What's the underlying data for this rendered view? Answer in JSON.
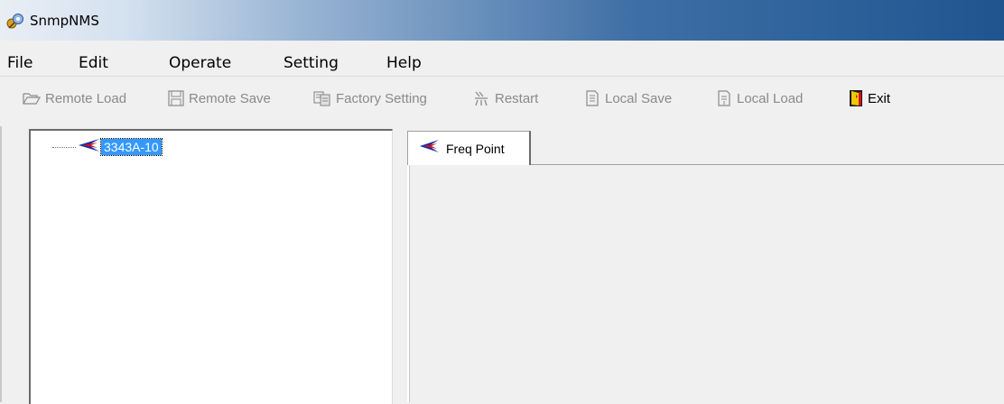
{
  "window": {
    "title": "SnmpNMS",
    "icon": "app-satellite-icon"
  },
  "menu": {
    "items": [
      "File",
      "Edit",
      "Operate",
      "Setting",
      "Help"
    ]
  },
  "toolbar": {
    "buttons": [
      {
        "label": "Remote Load",
        "icon": "folder-open-icon",
        "enabled": false
      },
      {
        "label": "Remote Save",
        "icon": "floppy-save-icon",
        "enabled": false
      },
      {
        "label": "Factory Setting",
        "icon": "factory-setting-icon",
        "enabled": false
      },
      {
        "label": "Restart",
        "icon": "restart-icon",
        "enabled": false
      },
      {
        "label": "Local Save",
        "icon": "local-save-icon",
        "enabled": false
      },
      {
        "label": "Local Load",
        "icon": "local-load-icon",
        "enabled": false
      },
      {
        "label": "Exit",
        "icon": "exit-door-icon",
        "enabled": true
      }
    ]
  },
  "tree": {
    "nodes": [
      {
        "label": "3343A-10",
        "icon": "device-arrow-icon",
        "selected": true
      }
    ]
  },
  "tabs": [
    {
      "label": "Freq Point",
      "icon": "device-arrow-icon",
      "active": true
    }
  ],
  "colors": {
    "selection": "#3399ff",
    "arrow_blue": "#1a2f9e",
    "arrow_red": "#d01020",
    "disabled_text": "#8a8a8a"
  }
}
